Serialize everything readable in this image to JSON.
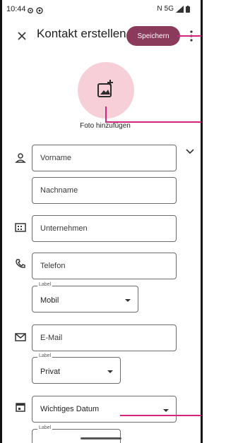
{
  "status": {
    "time": "10:44",
    "network": "5G",
    "left_icons": [
      "gear-icon",
      "record-icon"
    ],
    "right_icons": [
      "nfc-icon",
      "signal-icon",
      "battery-icon"
    ]
  },
  "appbar": {
    "title": "Kontakt erstellen",
    "save_label": "Speichern"
  },
  "photo": {
    "label": "Foto hinzufügen"
  },
  "fields": {
    "first_name": "Vorname",
    "last_name": "Nachname",
    "company": "Unternehmen",
    "phone": "Telefon",
    "phone_type": {
      "label": "Label",
      "value": "Mobil"
    },
    "email": "E-Mail",
    "email_type": {
      "label": "Label",
      "value": "Privat"
    },
    "date": "Wichtiges Datum",
    "date_label": {
      "label": "Label"
    }
  },
  "colors": {
    "accent": "#8a3a5a",
    "photo_bg": "#f6cfd8",
    "annotation": "#d4247f"
  }
}
